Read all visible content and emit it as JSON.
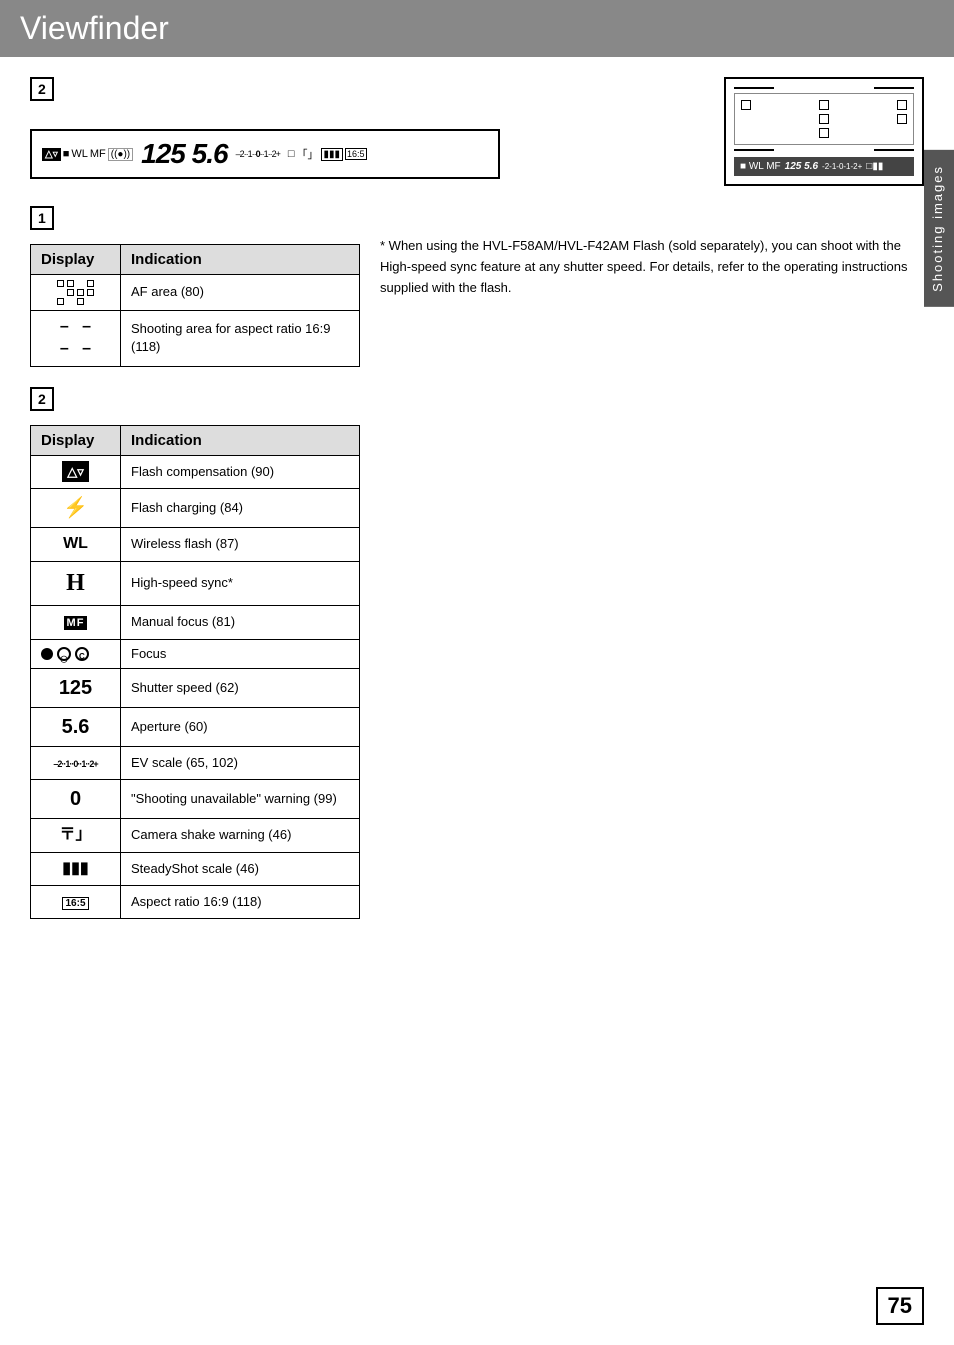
{
  "page": {
    "title": "Viewfinder",
    "page_number": "75"
  },
  "side_tab": {
    "label": "Shooting images"
  },
  "lcd_strip": {
    "numbers": "125  5.6",
    "scale": "–2··1··0··1··2+"
  },
  "section1": {
    "label": "1",
    "table": {
      "col1": "Display",
      "col2": "Indication",
      "rows": [
        {
          "display": "AF area grid",
          "indication": "AF area (80)"
        },
        {
          "display": "- -\n- -",
          "indication": "Shooting area for aspect ratio 16:9 (118)"
        }
      ]
    }
  },
  "section2": {
    "label": "2",
    "table": {
      "col1": "Display",
      "col2": "Indication",
      "rows": [
        {
          "display": "flash-comp-icon",
          "indication": "Flash compensation (90)"
        },
        {
          "display": "lightning",
          "indication": "Flash charging (84)"
        },
        {
          "display": "WL",
          "indication": "Wireless flash (87)"
        },
        {
          "display": "H",
          "indication": "High-speed sync*"
        },
        {
          "display": "MF",
          "indication": "Manual focus (81)"
        },
        {
          "display": "focus-icons",
          "indication": "Focus"
        },
        {
          "display": "125",
          "indication": "Shutter speed (62)"
        },
        {
          "display": "5.6",
          "indication": "Aperture (60)"
        },
        {
          "display": "ev-scale",
          "indication": "EV scale (65, 102)"
        },
        {
          "display": "0",
          "indication": "\"Shooting unavailable\" warning (99)"
        },
        {
          "display": "camera-shake",
          "indication": "Camera shake warning (46)"
        },
        {
          "display": "steady-shot",
          "indication": "SteadyShot scale (46)"
        },
        {
          "display": "aspect-box",
          "indication": "Aspect ratio 16:9 (118)"
        }
      ]
    }
  },
  "note": {
    "text": "* When using the HVL-F58AM/HVL-F42AM Flash (sold separately), you can shoot with the High-speed sync feature at any shutter speed. For details, refer to the operating instructions supplied with the flash."
  }
}
